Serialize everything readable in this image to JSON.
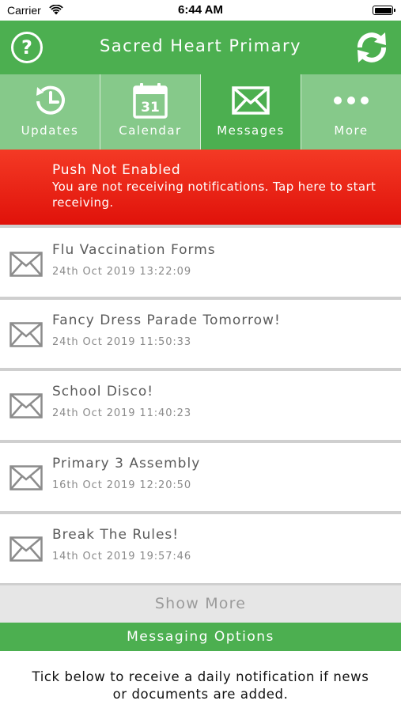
{
  "status_bar": {
    "carrier": "Carrier",
    "time": "6:44 AM"
  },
  "header": {
    "help_label": "?",
    "title": "Sacred Heart Primary",
    "icons": {
      "help": "help-circle-icon",
      "refresh": "refresh-icon"
    }
  },
  "tabs": [
    {
      "label": "Updates",
      "icon": "clock-history-icon",
      "active": false
    },
    {
      "label": "Calendar",
      "icon": "calendar-icon",
      "calendar_day": "31",
      "active": false
    },
    {
      "label": "Messages",
      "icon": "envelope-icon",
      "active": true
    },
    {
      "label": "More",
      "icon": "more-dots-icon",
      "active": false
    }
  ],
  "push_banner": {
    "title": "Push Not Enabled",
    "text": "You are not receiving notifications. Tap here to start receiving."
  },
  "messages": [
    {
      "title": "Flu Vaccination Forms",
      "date": "24th Oct 2019 13:22:09"
    },
    {
      "title": "Fancy Dress Parade Tomorrow!",
      "date": "24th Oct 2019 11:50:33"
    },
    {
      "title": "School Disco!",
      "date": "24th Oct 2019 11:40:23"
    },
    {
      "title": "Primary 3 Assembly",
      "date": "16th Oct 2019 12:20:50"
    },
    {
      "title": "Break The Rules!",
      "date": "14th Oct 2019 19:57:46"
    }
  ],
  "show_more_label": "Show More",
  "options_label": "Messaging Options",
  "info_text": "Tick below to receive a daily notification if news or documents are added.",
  "colors": {
    "primary_green": "#4caf50",
    "inactive_tab_green": "#86c98a",
    "alert_red": "#f43a25",
    "text_gray": "#5a5a5a"
  }
}
